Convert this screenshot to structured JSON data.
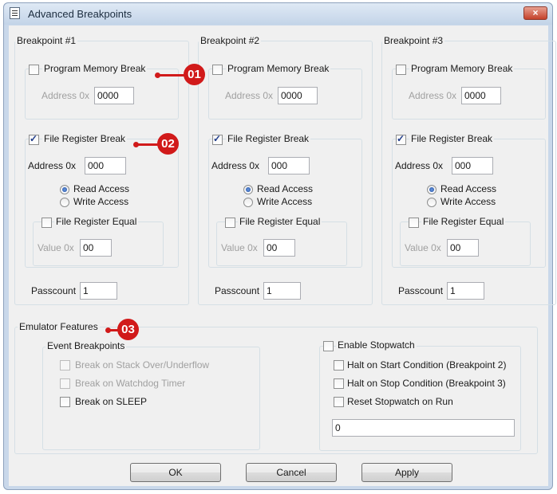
{
  "window": {
    "title": "Advanced Breakpoints",
    "close_glyph": "×"
  },
  "breakpoints": [
    {
      "legend": "Breakpoint #1",
      "program_memory_break": {
        "label": "Program Memory Break",
        "checked": false
      },
      "pm_address_label": "Address 0x",
      "pm_address_value": "0000",
      "file_register_break": {
        "label": "File Register Break",
        "checked": true
      },
      "fr_address_label": "Address 0x",
      "fr_address_value": "000",
      "read_access": "Read Access",
      "write_access": "Write Access",
      "file_register_equal": {
        "label": "File Register Equal",
        "checked": false
      },
      "value_label": "Value 0x",
      "value_value": "00",
      "passcount_label": "Passcount",
      "passcount_value": "1"
    },
    {
      "legend": "Breakpoint #2",
      "program_memory_break": {
        "label": "Program Memory Break",
        "checked": false
      },
      "pm_address_label": "Address 0x",
      "pm_address_value": "0000",
      "file_register_break": {
        "label": "File Register Break",
        "checked": true
      },
      "fr_address_label": "Address 0x",
      "fr_address_value": "000",
      "read_access": "Read Access",
      "write_access": "Write Access",
      "file_register_equal": {
        "label": "File Register Equal",
        "checked": false
      },
      "value_label": "Value 0x",
      "value_value": "00",
      "passcount_label": "Passcount",
      "passcount_value": "1"
    },
    {
      "legend": "Breakpoint #3",
      "program_memory_break": {
        "label": "Program Memory Break",
        "checked": false
      },
      "pm_address_label": "Address 0x",
      "pm_address_value": "0000",
      "file_register_break": {
        "label": "File Register Break",
        "checked": true
      },
      "fr_address_label": "Address 0x",
      "fr_address_value": "000",
      "read_access": "Read Access",
      "write_access": "Write Access",
      "file_register_equal": {
        "label": "File Register Equal",
        "checked": false
      },
      "value_label": "Value 0x",
      "value_value": "00",
      "passcount_label": "Passcount",
      "passcount_value": "1"
    }
  ],
  "emulator": {
    "legend": "Emulator Features",
    "event_breakpoints": {
      "legend": "Event Breakpoints",
      "stack": "Break on Stack Over/Underflow",
      "watchdog": "Break on Watchdog Timer",
      "sleep": "Break on SLEEP"
    },
    "stopwatch": {
      "enable": "Enable Stopwatch",
      "halt_start": "Halt on Start Condition (Breakpoint 2)",
      "halt_stop": "Halt on Stop Condition (Breakpoint 3)",
      "reset": "Reset Stopwatch on Run",
      "value": "0"
    }
  },
  "buttons": {
    "ok": "OK",
    "cancel": "Cancel",
    "apply": "Apply"
  },
  "markers": {
    "m1": "01",
    "m2": "02",
    "m3": "03"
  },
  "colors": {
    "marker": "#d11a1a",
    "check": "#1f3b8a",
    "disabled_text": "#a0a0a0"
  }
}
